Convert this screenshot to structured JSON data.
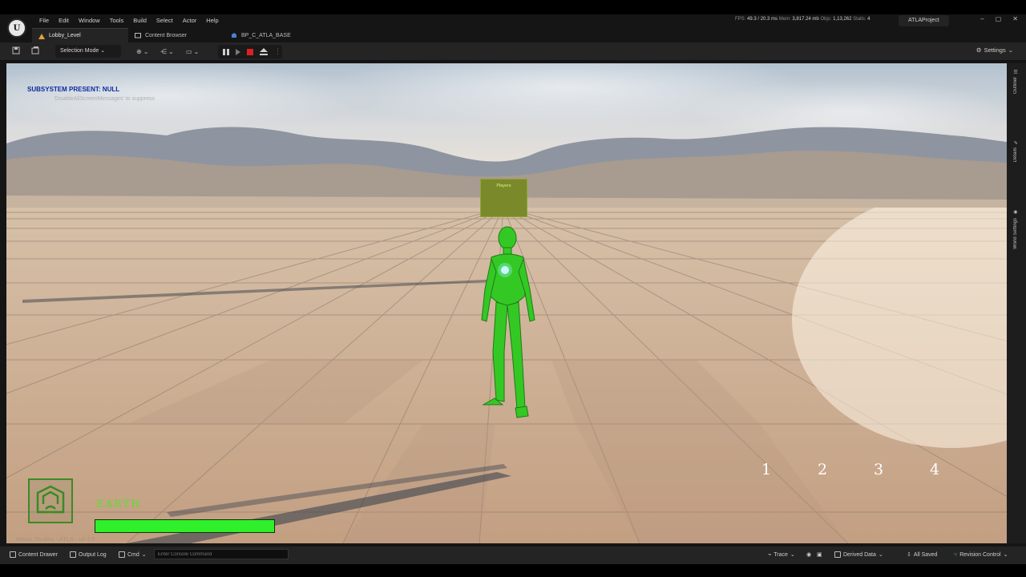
{
  "app": {
    "menu": [
      "File",
      "Edit",
      "Window",
      "Tools",
      "Build",
      "Select",
      "Actor",
      "Help"
    ],
    "stats": {
      "fps_label": "FPS:",
      "fps": "49.3",
      "ms": "/ 20.3 ms",
      "mem_label": "Mem:",
      "mem": "3,817.24 mb",
      "objs_label": "Objs:",
      "objs": "1,13,262",
      "stalls_label": "Stalls:",
      "stalls": "4"
    },
    "project_name": "ATLAProject",
    "window_buttons": {
      "minimize": "–",
      "maximize": "▢",
      "close": "✕"
    }
  },
  "tabs": [
    {
      "label": "Lobby_Level",
      "active": true
    },
    {
      "label": "Content Browser",
      "active": false
    },
    {
      "label": "BP_C_ATLA_BASE",
      "active": false
    }
  ],
  "toolbar": {
    "selection_mode": "Selection Mode",
    "settings": "Settings"
  },
  "viewport": {
    "debug_message": "SUBSYSTEM PRESENT: NULL",
    "debug_hint": "'DisableAllScreenMessages' to suppress",
    "players_label": "Players",
    "slot_numbers": [
      "1",
      "2",
      "3",
      "4"
    ],
    "element_name": "EARTH",
    "health_fraction": 1.0,
    "version": "Melon Studios - ATLA - v0.4.5",
    "colors": {
      "hud_green": "#2ff02a",
      "debug_blue": "#0a2aa0"
    }
  },
  "side_panel": {
    "tabs": [
      "Outliner",
      "Details",
      "World Settings"
    ]
  },
  "statusbar": {
    "content_drawer": "Content Drawer",
    "output_log": "Output Log",
    "cmd": "Cmd",
    "console_placeholder": "Enter Console Command",
    "trace": "Trace",
    "derived_data": "Derived Data",
    "all_saved": "All Saved",
    "revision_control": "Revision Control"
  }
}
